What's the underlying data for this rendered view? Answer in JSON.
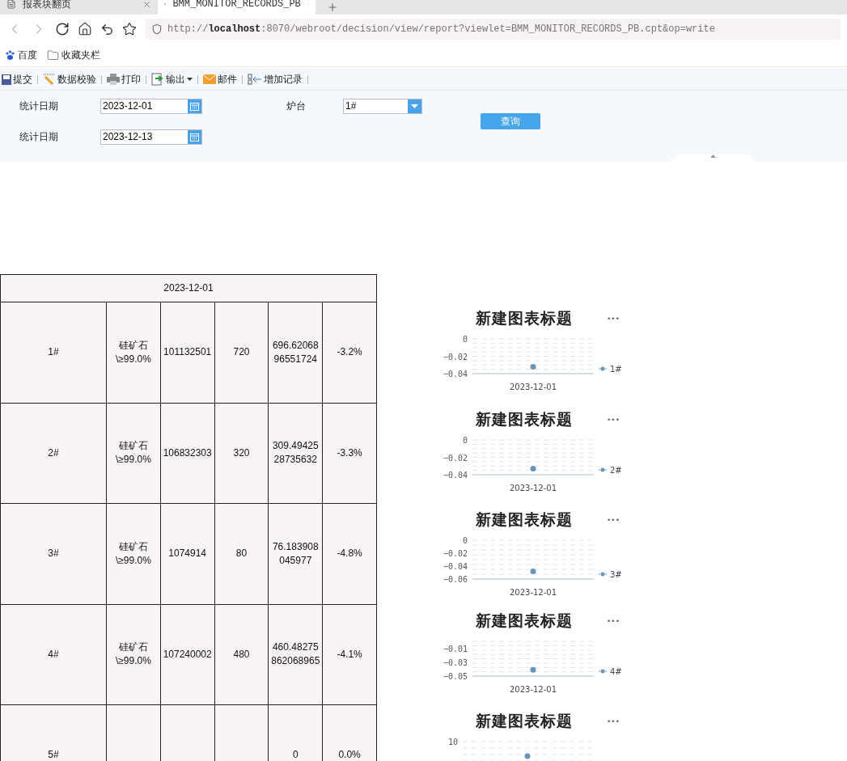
{
  "browser": {
    "tabs": [
      {
        "title": "报表块翻页",
        "selected": false
      },
      {
        "title": "BMM_MONITOR_RECORDS_PB",
        "selected": true
      }
    ],
    "address": "http://**localhost**:8070/webroot/decision/view/report?viewlet=BMM_MONITOR_RECORDS_PB.cpt&op=write",
    "bookmarks": [
      {
        "label": "百度",
        "kind": "paw"
      },
      {
        "label": "收藏夹栏",
        "kind": "folder"
      }
    ]
  },
  "toolbar": [
    {
      "label": "提交",
      "kind": "save",
      "dropdown": false
    },
    {
      "label": "数据校验",
      "kind": "check",
      "dropdown": false
    },
    {
      "label": "打印",
      "kind": "print",
      "dropdown": false
    },
    {
      "label": "输出",
      "kind": "export",
      "dropdown": true
    },
    {
      "label": "邮件",
      "kind": "mail",
      "dropdown": false
    },
    {
      "label": "增加记录",
      "kind": "add",
      "dropdown": false
    }
  ],
  "filters": {
    "start_date": {
      "label": "统计日期",
      "value": "2023-12-01"
    },
    "end_date": {
      "label": "统计日期",
      "value": "2023-12-13"
    },
    "furnace": {
      "label": "炉台",
      "value": "1#"
    },
    "query_button": "查询"
  },
  "table": {
    "header": "2023-12-01",
    "rows": [
      {
        "furnace": "1#",
        "material": "硅矿石 \\≥99.0%",
        "code": "101132501",
        "qty": "720",
        "value": "696.6206896551724",
        "change": "-3.2%"
      },
      {
        "furnace": "2#",
        "material": "硅矿石 \\≥99.0%",
        "code": "106832303",
        "qty": "320",
        "value": "309.4942528735632",
        "change": "-3.3%"
      },
      {
        "furnace": "3#",
        "material": "硅矿石 \\≥99.0%",
        "code": "1074914",
        "qty": "80",
        "value": "76.183908045977",
        "change": "-4.8%"
      },
      {
        "furnace": "4#",
        "material": "硅矿石 \\≥99.0%",
        "code": "107240002",
        "qty": "480",
        "value": "460.48275862068965",
        "change": "-4.1%"
      },
      {
        "furnace": "5#",
        "value": "0",
        "change": "0.0%"
      }
    ]
  },
  "charts": [
    {
      "title": "新建图表标题",
      "more": "•••",
      "chart_data": {
        "type": "scatter",
        "categories": [
          "2023-12-01"
        ],
        "series": [
          {
            "name": "1#",
            "color": "#6a94b8",
            "values": [
              -0.032
            ]
          }
        ],
        "ylim": [
          -0.04,
          0
        ],
        "yticks": [
          {
            "value": 0,
            "label": "0"
          },
          {
            "value": -0.02,
            "label": "−0.02"
          },
          {
            "value": -0.04,
            "label": "−0.04"
          }
        ]
      }
    },
    {
      "title": "新建图表标题",
      "more": "•••",
      "chart_data": {
        "type": "scatter",
        "categories": [
          "2023-12-01"
        ],
        "series": [
          {
            "name": "2#",
            "color": "#6a94b8",
            "values": [
              -0.033
            ]
          }
        ],
        "ylim": [
          -0.04,
          0
        ],
        "yticks": [
          {
            "value": 0,
            "label": "0"
          },
          {
            "value": -0.02,
            "label": "−0.02"
          },
          {
            "value": -0.04,
            "label": "−0.04"
          }
        ]
      }
    },
    {
      "title": "新建图表标题",
      "more": "•••",
      "chart_data": {
        "type": "scatter",
        "categories": [
          "2023-12-01"
        ],
        "series": [
          {
            "name": "3#",
            "color": "#6a94b8",
            "values": [
              -0.048
            ]
          }
        ],
        "ylim": [
          -0.06,
          0
        ],
        "yticks": [
          {
            "value": 0,
            "label": "0"
          },
          {
            "value": -0.02,
            "label": "−0.02"
          },
          {
            "value": -0.04,
            "label": "−0.04"
          },
          {
            "value": -0.06,
            "label": "−0.06"
          }
        ]
      }
    },
    {
      "title": "新建图表标题",
      "more": "•••",
      "chart_data": {
        "type": "scatter",
        "categories": [
          "2023-12-01"
        ],
        "series": [
          {
            "name": "4#",
            "color": "#6a94b8",
            "values": [
              -0.041
            ]
          }
        ],
        "ylim": [
          -0.05,
          0
        ],
        "yticks": [
          {
            "value": -0.01,
            "label": "−0.01"
          },
          {
            "value": -0.03,
            "label": "−0.03"
          },
          {
            "value": -0.05,
            "label": "−0.05"
          }
        ]
      }
    },
    {
      "title": "新建图表标题",
      "more": "•••",
      "tick_labels": [
        "10"
      ]
    }
  ]
}
